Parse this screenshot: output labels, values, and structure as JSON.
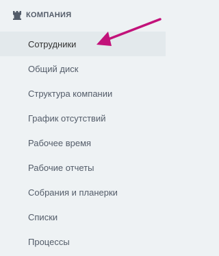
{
  "section": {
    "title": "КОМПАНИЯ",
    "icon": "castle-icon"
  },
  "menu": {
    "items": [
      {
        "label": "Сотрудники",
        "active": true
      },
      {
        "label": "Общий диск"
      },
      {
        "label": "Структура компании"
      },
      {
        "label": "График отсутствий"
      },
      {
        "label": "Рабочее время"
      },
      {
        "label": "Рабочие отчеты"
      },
      {
        "label": "Собрания и планерки"
      },
      {
        "label": "Списки"
      },
      {
        "label": "Процессы"
      }
    ]
  },
  "colors": {
    "background": "#eef2f4",
    "active_item_background": "#e3e9ec",
    "text": "#535c69",
    "arrow": "#c2127a"
  }
}
